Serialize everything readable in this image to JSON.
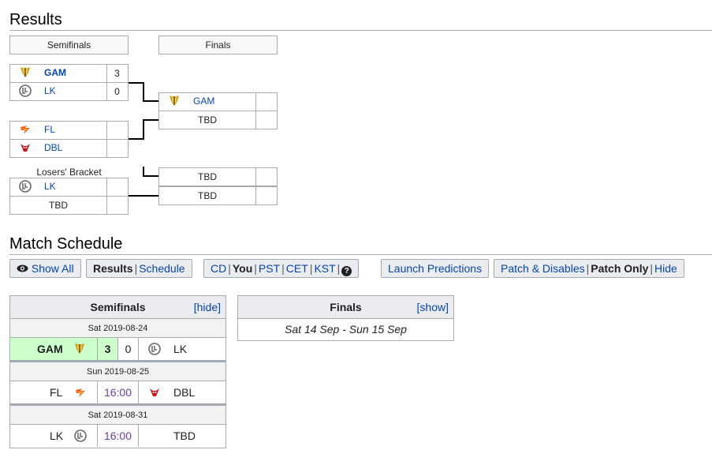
{
  "results": {
    "heading": "Results",
    "rounds": {
      "semifinals": "Semifinals",
      "finals": "Finals"
    },
    "semifinal1": {
      "top": {
        "team": "GAM",
        "score": "3",
        "icon": "gam-logo-icon"
      },
      "bottom": {
        "team": "LK",
        "score": "0",
        "icon": "lk-logo-icon"
      }
    },
    "semifinal2": {
      "top": {
        "team": "FL",
        "score": "",
        "icon": "fl-logo-icon"
      },
      "bottom": {
        "team": "DBL",
        "score": "",
        "icon": "dbl-logo-icon"
      }
    },
    "losers": {
      "caption": "Losers' Bracket",
      "top": {
        "team": "LK",
        "score": "",
        "icon": "lk-logo-icon"
      },
      "bottom": {
        "team": "TBD",
        "score": ""
      }
    },
    "final1": {
      "top": {
        "team": "GAM",
        "score": "",
        "icon": "gam-logo-icon"
      },
      "bottom": {
        "team": "TBD",
        "score": ""
      }
    },
    "final2": {
      "top": {
        "team": "TBD",
        "score": ""
      },
      "bottom": {
        "team": "TBD",
        "score": ""
      }
    }
  },
  "schedule": {
    "heading": "Match Schedule",
    "toolbar": {
      "show_all": "Show All",
      "results": "Results",
      "schedule": "Schedule",
      "tz": [
        "CD",
        "You",
        "PST",
        "CET",
        "KST"
      ],
      "help": "?",
      "launch": "Launch Predictions",
      "patch_disables": "Patch & Disables",
      "patch_only": "Patch Only",
      "hide": "Hide"
    },
    "semifinals": {
      "title": "Semifinals",
      "toggle": "[hide]",
      "days": [
        {
          "date": "Sat 2019-08-24",
          "team1": "GAM",
          "team2": "LK",
          "score1": "3",
          "score2": "0",
          "winner": 1
        },
        {
          "date": "Sun 2019-08-25",
          "team1": "FL",
          "team2": "DBL",
          "time": "16:00"
        },
        {
          "date": "Sat 2019-08-31",
          "team1": "LK",
          "team2": "TBD",
          "time": "16:00"
        }
      ]
    },
    "finals": {
      "title": "Finals",
      "toggle": "[show]",
      "dates": "Sat 14 Sep - Sun 15 Sep"
    }
  },
  "colors": {
    "link": "#0645ad",
    "time": "#6b3fa0",
    "win": "#ccffcc",
    "gam_gold": "#d4a017",
    "fl_orange": "#f26a21",
    "dbl_red": "#c4161c"
  }
}
